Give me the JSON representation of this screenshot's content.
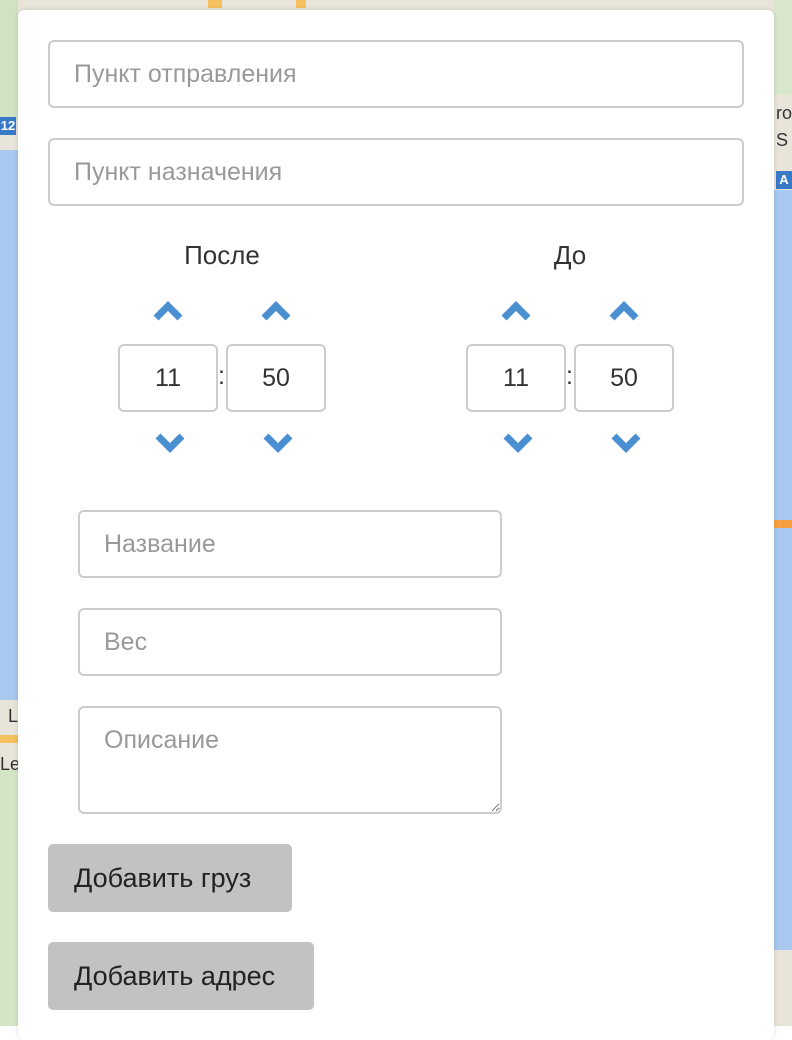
{
  "map": {
    "shield_left": "12",
    "shield_right": "A",
    "label_right_1": "ro",
    "label_right_2": "S",
    "label_left_1": "L",
    "label_left_2": "Le"
  },
  "route": {
    "origin_placeholder": "Пункт отправления",
    "destination_placeholder": "Пункт назначения"
  },
  "time_window": {
    "after": {
      "label": "После",
      "hours": "11",
      "minutes": "50"
    },
    "before": {
      "label": "До",
      "hours": "11",
      "minutes": "50"
    },
    "separator": ":"
  },
  "cargo": {
    "name_placeholder": "Название",
    "weight_placeholder": "Вес",
    "description_placeholder": "Описание"
  },
  "actions": {
    "add_cargo_label": "Добавить груз",
    "add_address_label": "Добавить адрес"
  },
  "colors": {
    "accent": "#4a8fd0",
    "button_bg": "#c2c2c2",
    "border": "#cccccc",
    "placeholder": "#999999"
  },
  "icons": {
    "increment": "chevron-up-icon",
    "decrement": "chevron-down-icon"
  }
}
